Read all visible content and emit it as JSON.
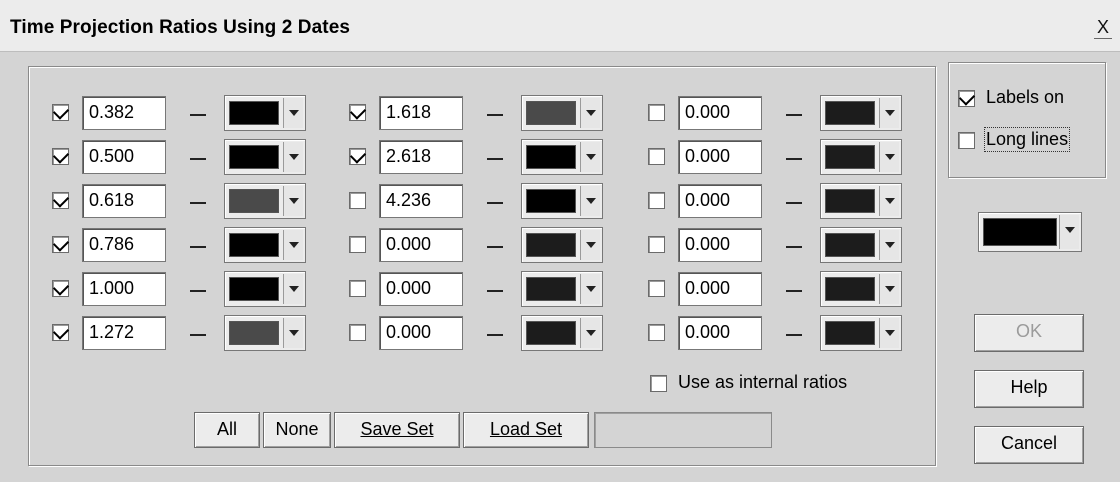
{
  "window": {
    "title": "Time Projection Ratios Using 2 Dates",
    "close_glyph": "X"
  },
  "colors": {
    "black": "#000000",
    "dark_gray": "#4a4a4a",
    "near_black": "#1c1c1c",
    "background": "#d4d4d4"
  },
  "columns": [
    {
      "rows": [
        {
          "checked": true,
          "value": "0.382",
          "dash": "–",
          "color": "#000000"
        },
        {
          "checked": true,
          "value": "0.500",
          "dash": "–",
          "color": "#000000"
        },
        {
          "checked": true,
          "value": "0.618",
          "dash": "–",
          "color": "#4a4a4a"
        },
        {
          "checked": true,
          "value": "0.786",
          "dash": "–",
          "color": "#000000"
        },
        {
          "checked": true,
          "value": "1.000",
          "dash": "–",
          "color": "#000000"
        },
        {
          "checked": true,
          "value": "1.272",
          "dash": "–",
          "color": "#4a4a4a"
        }
      ]
    },
    {
      "rows": [
        {
          "checked": true,
          "value": "1.618",
          "dash": "–",
          "color": "#4a4a4a"
        },
        {
          "checked": true,
          "value": "2.618",
          "dash": "–",
          "color": "#000000"
        },
        {
          "checked": false,
          "value": "4.236",
          "dash": "–",
          "color": "#000000"
        },
        {
          "checked": false,
          "value": "0.000",
          "dash": "–",
          "color": "#1c1c1c"
        },
        {
          "checked": false,
          "value": "0.000",
          "dash": "–",
          "color": "#1c1c1c"
        },
        {
          "checked": false,
          "value": "0.000",
          "dash": "–",
          "color": "#1c1c1c"
        }
      ]
    },
    {
      "rows": [
        {
          "checked": false,
          "value": "0.000",
          "dash": "–",
          "color": "#1c1c1c"
        },
        {
          "checked": false,
          "value": "0.000",
          "dash": "–",
          "color": "#1c1c1c"
        },
        {
          "checked": false,
          "value": "0.000",
          "dash": "–",
          "color": "#1c1c1c"
        },
        {
          "checked": false,
          "value": "0.000",
          "dash": "–",
          "color": "#1c1c1c"
        },
        {
          "checked": false,
          "value": "0.000",
          "dash": "–",
          "color": "#1c1c1c"
        },
        {
          "checked": false,
          "value": "0.000",
          "dash": "–",
          "color": "#1c1c1c"
        }
      ]
    }
  ],
  "internal_ratios": {
    "checked": false,
    "label": "Use as internal ratios"
  },
  "bottom_buttons": {
    "all": "All",
    "none": "None",
    "save_set": "Save Set",
    "load_set": "Load Set"
  },
  "options": {
    "labels_on": {
      "checked": true,
      "label": "Labels on"
    },
    "long_lines": {
      "checked": false,
      "label": "Long lines"
    }
  },
  "line_color": "#000000",
  "dialog_buttons": {
    "ok": "OK",
    "help": "Help",
    "cancel": "Cancel"
  }
}
